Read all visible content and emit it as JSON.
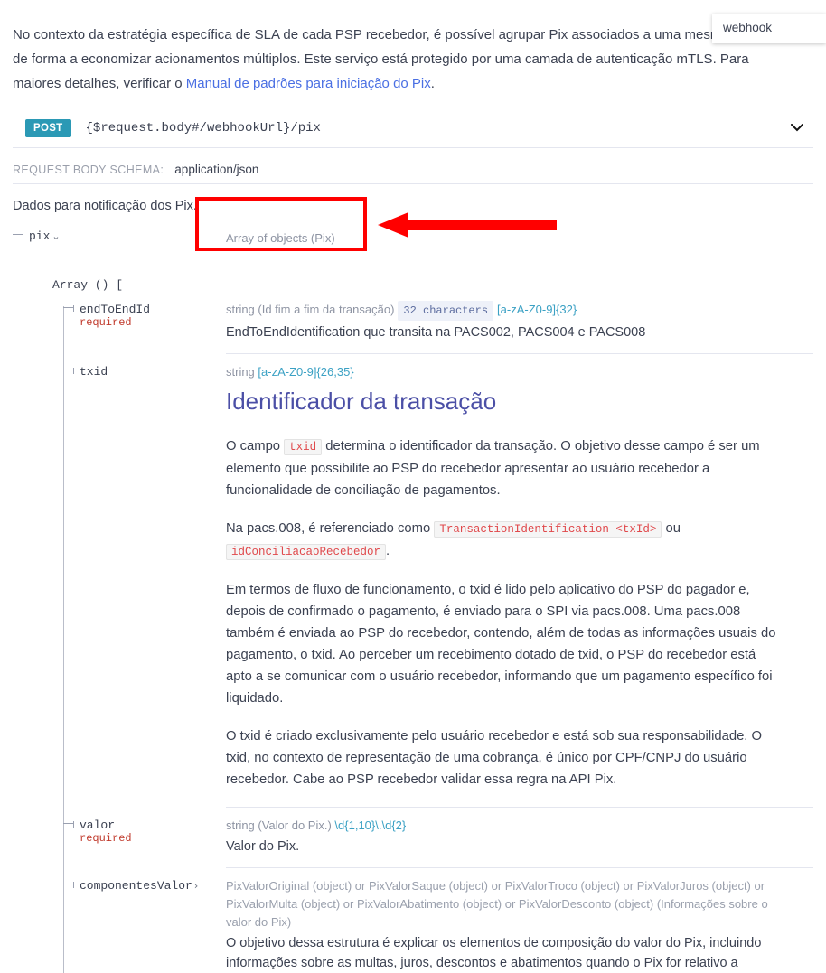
{
  "popup": {
    "label": "webhook"
  },
  "intro": {
    "text_part1": "No contexto da estratégia específica de SLA de cada PSP recebedor, é possível agrupar Pix associados a uma mesma chave, de forma a economizar acionamentos múltiplos. Este serviço está protegido por uma camada de autenticação mTLS. Para maiores detalhes, verificar o ",
    "link_text": "Manual de padrões para iniciação do Pix",
    "text_part2": "."
  },
  "operation": {
    "method": "POST",
    "path": "{$request.body#/webhookUrl}/pix",
    "collapse_icon": "chevron-down-icon"
  },
  "request_body": {
    "label": "REQUEST BODY SCHEMA:",
    "value": "application/json"
  },
  "description": "Dados para notificação dos Pix.",
  "tree": {
    "root": {
      "name": "pix",
      "caret": "⌄",
      "type": "Array of objects (Pix)"
    },
    "array_header": "Array () [",
    "fields": [
      {
        "name": "endToEndId",
        "required": "required",
        "type_prefix": "string (Id fim a fim da transação)",
        "badge": "32 characters",
        "pattern": "[a-zA-Z0-9]{32}",
        "description": "EndToEndIdentification que transita na PACS002, PACS004 e PACS008"
      },
      {
        "name": "txid",
        "required": "",
        "type_prefix": "string",
        "badge": "",
        "pattern": "[a-zA-Z0-9]{26,35}",
        "description": ""
      },
      {
        "name": "valor",
        "required": "required",
        "type_prefix": "string (Valor do Pix.)",
        "badge": "",
        "pattern": "\\d{1,10}\\.\\d{2}",
        "description": "Valor do Pix."
      },
      {
        "name": "componentesValor",
        "caret": "›",
        "required": "",
        "type_prefix": "PixValorOriginal (object) or PixValorSaque (object) or PixValorTroco (object) or PixValorJuros (object) or PixValorMulta (object) or PixValorAbatimento (object) or PixValorDesconto (object) (Informações sobre o valor do Pix)",
        "badge": "",
        "pattern": "",
        "description": "O objetivo dessa estrutura é explicar os elementos de composição do valor do Pix, incluindo informações sobre as multas, juros, descontos e abatimentos quando o Pix for relativo a"
      }
    ]
  },
  "txid_doc": {
    "heading": "Identificador da transação",
    "p1_a": "O campo ",
    "p1_code": "txid",
    "p1_b": " determina o identificador da transação. O objetivo desse campo é ser um elemento que possibilite ao PSP do recebedor apresentar ao usuário recebedor a funcionalidade de conciliação de pagamentos.",
    "p2_a": "Na pacs.008, é referenciado como ",
    "p2_code1": "TransactionIdentification <txId>",
    "p2_b": " ou ",
    "p2_code2": "idConciliacaoRecebedor",
    "p2_c": ".",
    "p3": "Em termos de fluxo de funcionamento, o txid é lido pelo aplicativo do PSP do pagador e, depois de confirmado o pagamento, é enviado para o SPI via pacs.008. Uma pacs.008 também é enviada ao PSP do recebedor, contendo, além de todas as informações usuais do pagamento, o txid. Ao perceber um recebimento dotado de txid, o PSP do recebedor está apto a se comunicar com o usuário recebedor, informando que um pagamento específico foi liquidado.",
    "p4": "O txid é criado exclusivamente pelo usuário recebedor e está sob sua responsabilidade. O txid, no contexto de representação de uma cobrança, é único por CPF/CNPJ do usuário recebedor. Cabe ao PSP recebedor validar essa regra na API Pix."
  },
  "annotations": {
    "highlight_color": "#ff0000",
    "box_label": "array-of-objects-highlight",
    "arrow_label": "pointer-arrow"
  },
  "colors": {
    "method_post": "#2b99b5",
    "link": "#4a6fe3",
    "heading": "#4b4fa6",
    "required": "#c0392b",
    "muted": "#8e94a3",
    "pattern": "#3ba1c4",
    "code_red": "#e0484b"
  }
}
